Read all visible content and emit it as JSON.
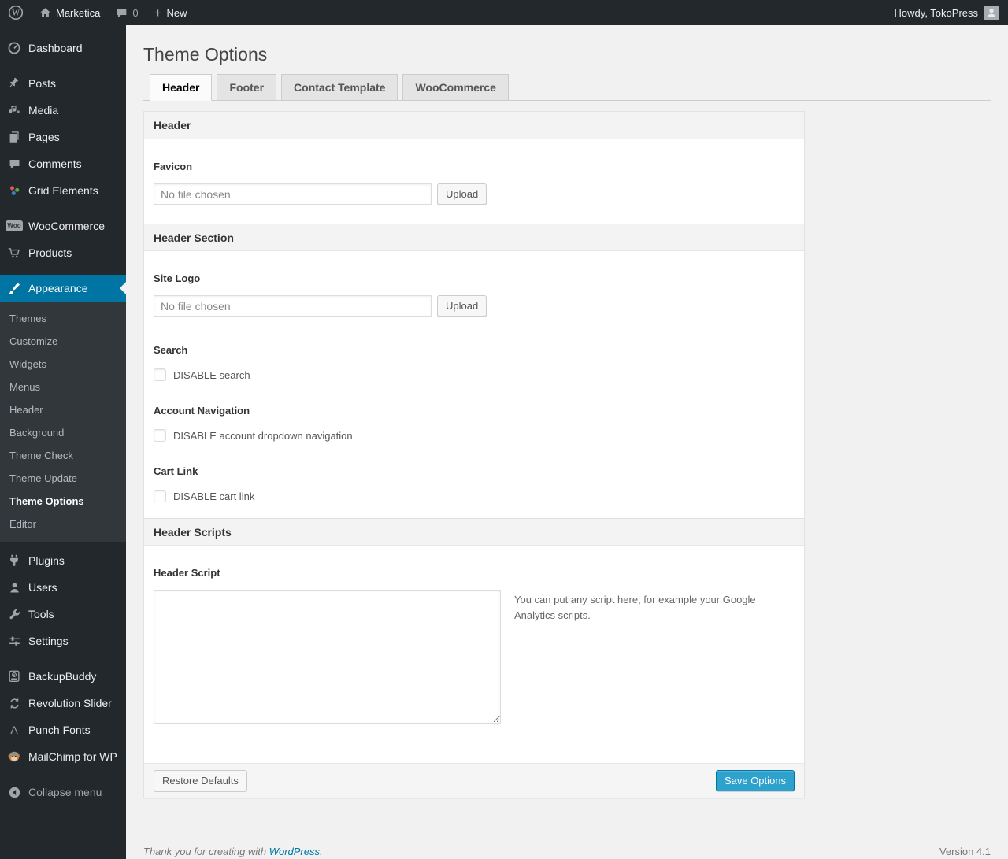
{
  "colors": {
    "accent": "#0074a2",
    "primary_button": "#2ea2cc",
    "sidebar_bg": "#23282d",
    "page_bg": "#f1f1f1"
  },
  "admin_bar": {
    "site_name": "Marketica",
    "comment_count": "0",
    "new_label": "New",
    "howdy": "Howdy, TokoPress"
  },
  "sidebar": {
    "items": [
      {
        "label": "Dashboard",
        "icon": "dashboard-icon"
      },
      {
        "label": "Posts",
        "icon": "pin-icon"
      },
      {
        "label": "Media",
        "icon": "media-icon"
      },
      {
        "label": "Pages",
        "icon": "pages-icon"
      },
      {
        "label": "Comments",
        "icon": "comment-icon"
      },
      {
        "label": "Grid Elements",
        "icon": "grid-elements-icon"
      },
      {
        "label": "WooCommerce",
        "icon": "woo-badge-icon"
      },
      {
        "label": "Products",
        "icon": "cart-icon"
      },
      {
        "label": "Appearance",
        "icon": "brush-icon"
      },
      {
        "label": "Plugins",
        "icon": "plugin-icon"
      },
      {
        "label": "Users",
        "icon": "user-icon"
      },
      {
        "label": "Tools",
        "icon": "wrench-icon"
      },
      {
        "label": "Settings",
        "icon": "sliders-icon"
      },
      {
        "label": "BackupBuddy",
        "icon": "backup-icon"
      },
      {
        "label": "Revolution Slider",
        "icon": "refresh-icon"
      },
      {
        "label": "Punch Fonts",
        "icon": "letter-a-icon"
      },
      {
        "label": "MailChimp for WP",
        "icon": "monkey-icon"
      },
      {
        "label": "Collapse menu",
        "icon": "collapse-arrow-icon"
      }
    ],
    "appearance_submenu": [
      "Themes",
      "Customize",
      "Widgets",
      "Menus",
      "Header",
      "Background",
      "Theme Check",
      "Theme Update",
      "Theme Options",
      "Editor"
    ],
    "active_item": "Appearance",
    "current_submenu_item": "Theme Options"
  },
  "page": {
    "title": "Theme Options",
    "tabs": [
      {
        "label": "Header",
        "active": true
      },
      {
        "label": "Footer",
        "active": false
      },
      {
        "label": "Contact Template",
        "active": false
      },
      {
        "label": "WooCommerce",
        "active": false
      }
    ]
  },
  "panel": {
    "section_header_title": "Header",
    "favicon_label": "Favicon",
    "file_placeholder": "No file chosen",
    "upload_label": "Upload",
    "section_header_section_title": "Header Section",
    "site_logo_label": "Site Logo",
    "search_label": "Search",
    "disable_search_label": "DISABLE search",
    "account_nav_label": "Account Navigation",
    "disable_account_label": "DISABLE account dropdown navigation",
    "cart_link_label": "Cart Link",
    "disable_cart_label": "DISABLE cart link",
    "section_header_scripts_title": "Header Scripts",
    "header_script_label": "Header Script",
    "header_script_value": "",
    "script_hint": "You can put any script here, for example your Google Analytics scripts.",
    "restore_label": "Restore Defaults",
    "save_label": "Save Options"
  },
  "footer": {
    "thanks_prefix": "Thank you for creating with ",
    "wordpress_link": "WordPress",
    "period": ".",
    "version": "Version 4.1"
  }
}
